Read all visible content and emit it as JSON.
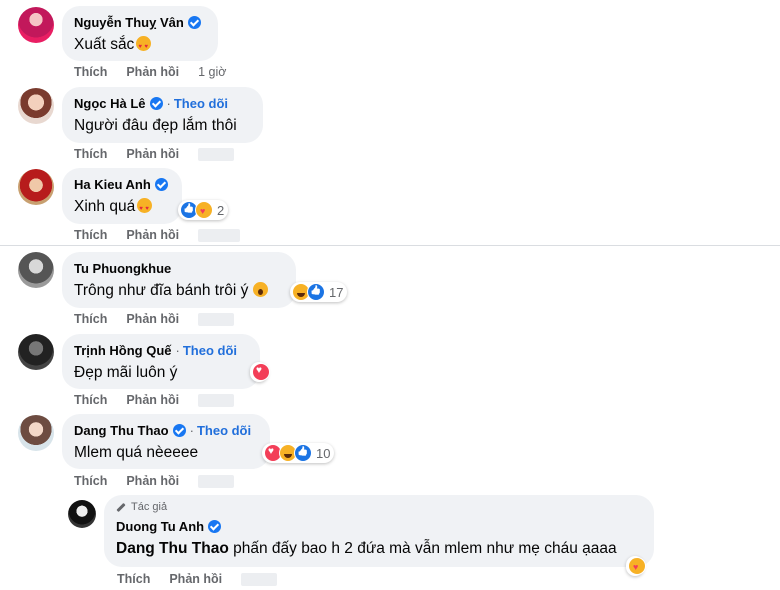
{
  "actions": {
    "like": "Thích",
    "reply": "Phản hồi"
  },
  "follow_label": "Theo dõi",
  "comments": [
    {
      "name": "Nguyễn Thuỵ Vân",
      "text": "Xuất sắc",
      "time": "1 giờ"
    },
    {
      "name": "Ngọc Hà Lê",
      "text": "Người đâu đẹp lắm thôi"
    },
    {
      "name": "Ha Kieu Anh",
      "text": "Xinh quá",
      "reaction_count": "2"
    },
    {
      "name": "Tu Phuongkhue",
      "text": "Trông như đĩa bánh trôi ý",
      "reaction_count": "17"
    },
    {
      "name": "Trịnh Hồng Quế",
      "text": "Đẹp mãi luôn ý"
    },
    {
      "name": "Dang Thu Thao",
      "text": "Mlem quá nèeeee",
      "reaction_count": "10"
    }
  ],
  "reply": {
    "author_tag": "Tác giả",
    "name": "Duong Tu Anh",
    "mention": "Dang Thu Thao",
    "text": " phấn đấy bao h 2 đứa mà vẫn mlem như mẹ cháu ạaaa"
  },
  "colors": {
    "bubble": "#f0f2f5",
    "verified": "#1877f2",
    "follow": "#216fdb",
    "meta": "#65676b"
  },
  "icons": [
    "verified-badge-icon",
    "heart-eyes-emoji-icon",
    "like-reaction-icon",
    "love-reaction-icon",
    "haha-reaction-icon",
    "care-reaction-icon",
    "pencil-icon"
  ]
}
